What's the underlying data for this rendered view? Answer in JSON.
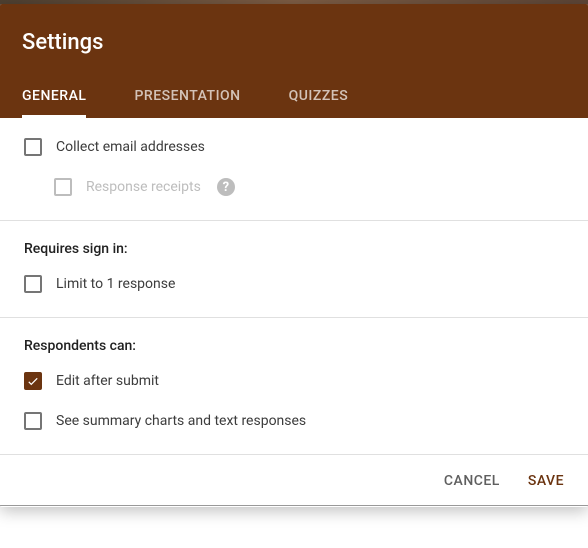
{
  "title": "Settings",
  "tabs": {
    "general": "GENERAL",
    "presentation": "PRESENTATION",
    "quizzes": "QUIZZES"
  },
  "sections": {
    "emails": {
      "collect_label": "Collect email addresses",
      "receipts_label": "Response receipts"
    },
    "signin": {
      "title": "Requires sign in:",
      "limit_label": "Limit to 1 response"
    },
    "respondents": {
      "title": "Respondents can:",
      "edit_label": "Edit after submit",
      "summary_label": "See summary charts and text responses"
    }
  },
  "footer": {
    "cancel": "CANCEL",
    "save": "SAVE"
  },
  "help_glyph": "?"
}
